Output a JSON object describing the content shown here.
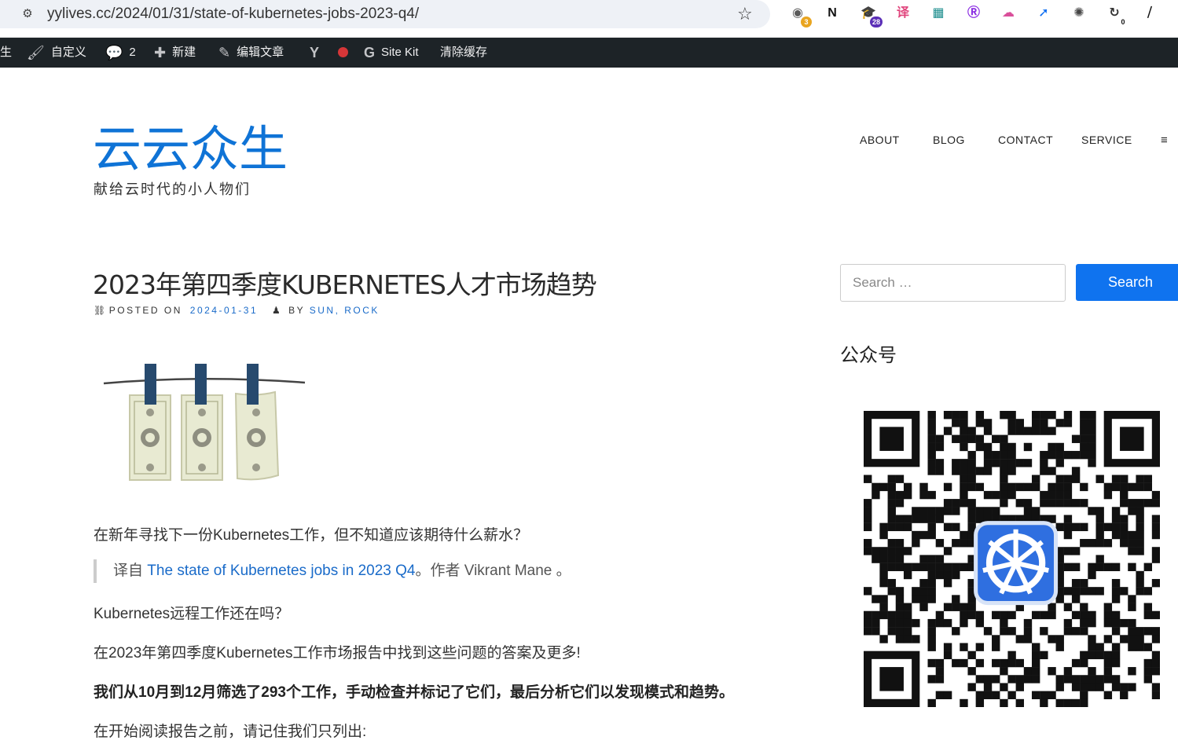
{
  "browser": {
    "url": "yylives.cc/2024/01/31/state-of-kubernetes-jobs-2023-q4/",
    "extensions": [
      {
        "name": "chatgpt-ext-icon",
        "glyph": "◉",
        "color": "#5a5a5a",
        "badge": "3",
        "badge_color": "#e9a520"
      },
      {
        "name": "notion-icon",
        "glyph": "N",
        "color": "#111111"
      },
      {
        "name": "graduation-cap-icon",
        "glyph": "🎓",
        "color": "#5b2fb7",
        "badge": "28",
        "badge_color": "#5b2fb7"
      },
      {
        "name": "translate-icon",
        "glyph": "译",
        "color": "#e0447c"
      },
      {
        "name": "grid-ext-icon",
        "glyph": "▦",
        "color": "#1a8c8c"
      },
      {
        "name": "purple-r-icon",
        "glyph": "Ⓡ",
        "color": "#8a2be2"
      },
      {
        "name": "cloud-ext-icon",
        "glyph": "☁",
        "color": "#d94f9a"
      },
      {
        "name": "blue-arrow-icon",
        "glyph": "➚",
        "color": "#0a6cf2"
      },
      {
        "name": "openai-icon",
        "glyph": "✺",
        "color": "#444444"
      },
      {
        "name": "refresh-ext-icon",
        "glyph": "↻",
        "color": "#333333",
        "badge": "0",
        "badge_color": "#ffffff"
      },
      {
        "name": "dark-ext-icon",
        "glyph": "⧸",
        "color": "#111111"
      }
    ]
  },
  "admin_bar": {
    "site_fragment": "生",
    "customize": "自定义",
    "comments_count": "2",
    "new": "新建",
    "edit_post": "编辑文章",
    "site_kit": "Site Kit",
    "clear_cache": "清除缓存"
  },
  "site": {
    "title": "云云众生",
    "description": "献给云时代的小人物们"
  },
  "nav": {
    "items": [
      "ABOUT",
      "BLOG",
      "CONTACT",
      "SERVICE"
    ],
    "menu_glyph": "≡"
  },
  "post": {
    "title": "2023年第四季度KUBERNETES人才市场趋势",
    "posted_on_label": "POSTED ON",
    "date": "2024-01-31",
    "by_label": "BY",
    "author": "SUN, ROCK",
    "p1": "在新年寻找下一份Kubernetes工作，但不知道应该期待什么薪水？",
    "quote_prefix": "译自",
    "quote_link": "The state of Kubernetes jobs in 2023 Q4",
    "quote_suffix": "。作者 Vikrant Mane 。",
    "p2": "Kubernetes远程工作还在吗？",
    "p3": "在2023年第四季度Kubernetes工作市场报告中找到这些问题的答案及更多!",
    "p4": "我们从10月到12月筛选了293个工作，手动检查并标记了它们，最后分析它们以发现模式和趋势。",
    "p5": "在开始阅读报告之前，请记住我们只列出:"
  },
  "sidebar": {
    "search_placeholder": "Search …",
    "search_button": "Search",
    "widget_title": "公众号"
  }
}
